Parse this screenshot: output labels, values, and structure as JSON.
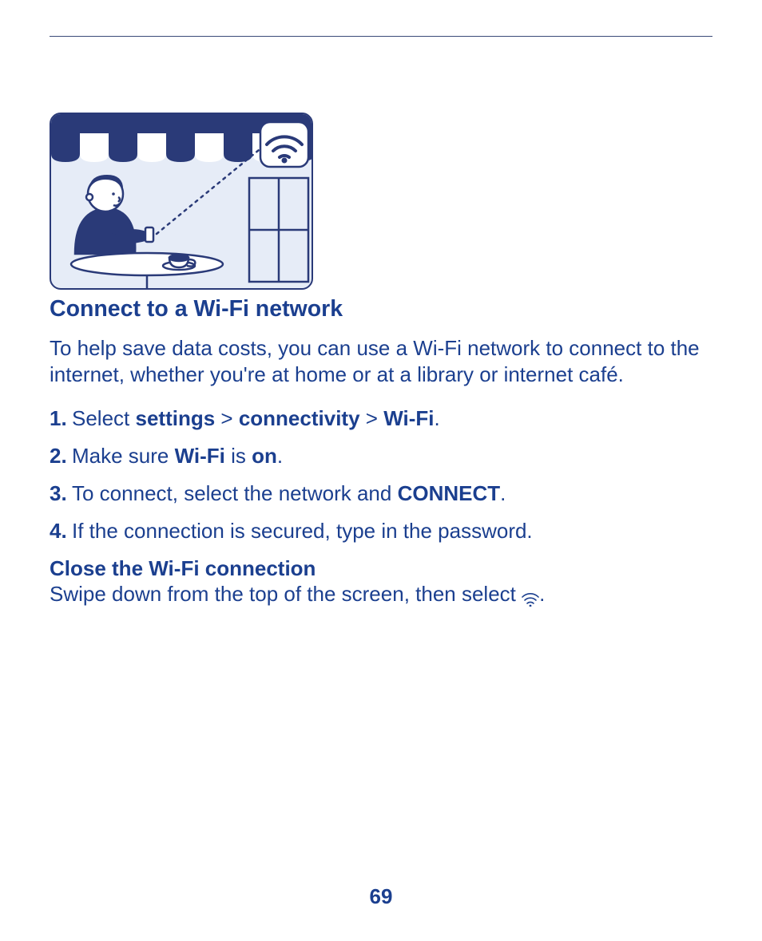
{
  "heading": "Connect to a Wi-Fi network",
  "intro": "To help save data costs, you can use a Wi-Fi network to connect to the internet, whether you're at home or at a library or internet café.",
  "steps": [
    {
      "num": "1.",
      "pre": "Select ",
      "b1": "settings",
      "mid1": " > ",
      "b2": "connectivity",
      "mid2": " > ",
      "b3": "Wi-Fi",
      "post": "."
    },
    {
      "num": "2.",
      "pre": "Make sure ",
      "b1": "Wi-Fi",
      "mid1": " is ",
      "b2": "on",
      "post": "."
    },
    {
      "num": "3.",
      "pre": "To connect, select the network and ",
      "b1": "CONNECT",
      "post": "."
    },
    {
      "num": "4.",
      "pre": "If the connection is secured, type in the password."
    }
  ],
  "subheading": "Close the Wi-Fi connection",
  "closing_pre": "Swipe down from the top of the screen, then select ",
  "closing_post": ".",
  "page_number": "69"
}
